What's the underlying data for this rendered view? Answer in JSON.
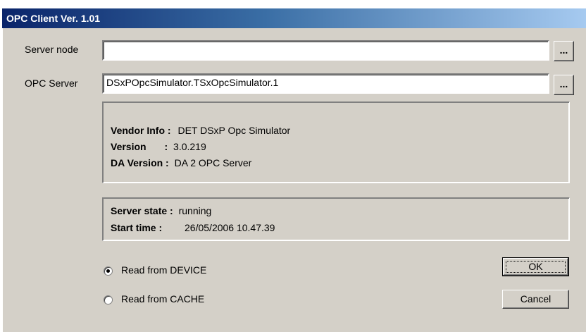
{
  "window": {
    "title": "OPC Client Ver. 1.01"
  },
  "server_node": {
    "label": "Server node",
    "value": "",
    "browse_label": "..."
  },
  "opc_server": {
    "label": "OPC Server",
    "value": "DSxPOpcSimulator.TSxOpcSimulator.1",
    "browse_label": "..."
  },
  "vendor_group": {
    "vendor_key": "Vendor Info :",
    "vendor_value": "DET DSxP Opc Simulator",
    "version_key": "Version",
    "version_sep": ":",
    "version_value": "3.0.219",
    "da_key": "DA Version :",
    "da_value": "DA 2 OPC Server"
  },
  "state_group": {
    "state_key": "Server state :",
    "state_value": "running",
    "start_key": "Start time :",
    "start_value": "26/05/2006 10.47.39"
  },
  "read_options": [
    {
      "label": "Read from DEVICE",
      "checked": true
    },
    {
      "label": "Read from CACHE",
      "checked": false
    }
  ],
  "buttons": {
    "ok": "OK",
    "cancel": "Cancel"
  }
}
